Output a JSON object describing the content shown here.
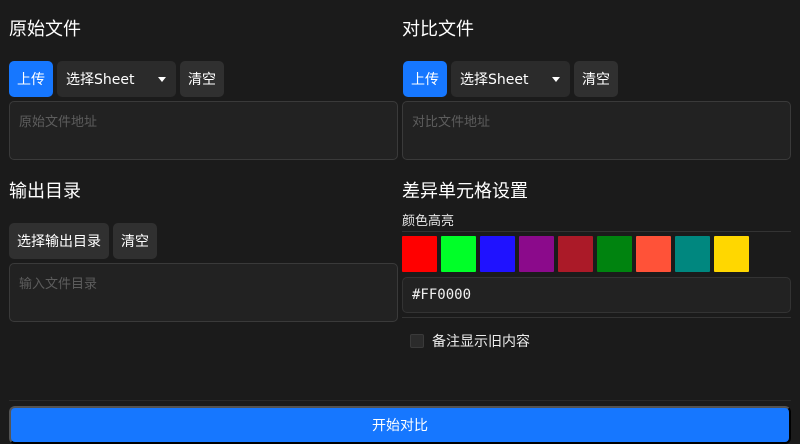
{
  "source": {
    "title": "原始文件",
    "upload_label": "上传",
    "sheet_select": "选择Sheet",
    "clear_label": "清空",
    "path_placeholder": "原始文件地址"
  },
  "compare": {
    "title": "对比文件",
    "upload_label": "上传",
    "sheet_select": "选择Sheet",
    "clear_label": "清空",
    "path_placeholder": "对比文件地址"
  },
  "output": {
    "title": "输出目录",
    "choose_label": "选择输出目录",
    "clear_label": "清空",
    "path_placeholder": "输入文件目录"
  },
  "diff": {
    "title": "差异单元格设置",
    "highlight_label": "颜色高亮",
    "colors": [
      "#ff0000",
      "#00ff28",
      "#1f12ff",
      "#8b0a8b",
      "#ab1a28",
      "#00830f",
      "#ff5238",
      "#00877f",
      "#ffd700"
    ],
    "color_value": "#FF0000",
    "show_old_label": "备注显示旧内容",
    "show_old_checked": false
  },
  "start_label": "开始对比",
  "icons": {
    "select_caret": "caret-down-icon"
  }
}
